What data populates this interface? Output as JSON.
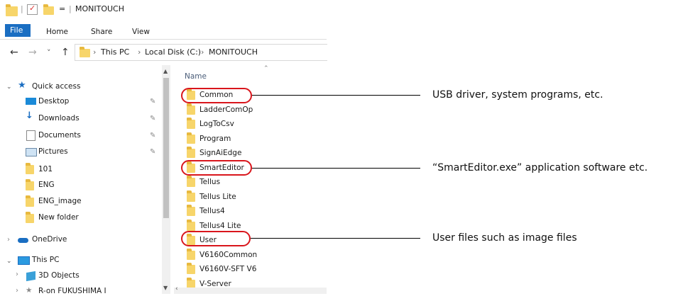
{
  "window": {
    "title": "MONITOUCH",
    "qat_separator": "|",
    "qat_dropdown": "=",
    "title_separator": "|"
  },
  "ribbon": {
    "tabs": [
      "File",
      "Home",
      "Share",
      "View"
    ]
  },
  "address": {
    "back": "←",
    "forward": "→",
    "recent": "˅",
    "up": "↑",
    "crumb_sep": "›",
    "path": [
      "This PC",
      "Local Disk (C:)",
      "MONITOUCH"
    ]
  },
  "nav": {
    "quick_access": "Quick access",
    "quick_items": [
      {
        "label": "Desktop",
        "icon": "desktop-icon",
        "pinned": true
      },
      {
        "label": "Downloads",
        "icon": "download-icon",
        "pinned": true
      },
      {
        "label": "Documents",
        "icon": "document-icon",
        "pinned": true
      },
      {
        "label": "Pictures",
        "icon": "pictures-icon",
        "pinned": true
      },
      {
        "label": "101",
        "icon": "folder-icon",
        "pinned": false
      },
      {
        "label": "ENG",
        "icon": "folder-icon",
        "pinned": false
      },
      {
        "label": "ENG_image",
        "icon": "folder-icon",
        "pinned": false
      },
      {
        "label": "New folder",
        "icon": "folder-icon",
        "pinned": false
      }
    ],
    "onedrive": "OneDrive",
    "this_pc": "This PC",
    "objects3d": "3D Objects",
    "last_item": "R-on FUKUSHIMA I",
    "pin_glyph": "📌"
  },
  "list": {
    "header": "Name",
    "items": [
      "Common",
      "LadderComOp",
      "LogToCsv",
      "Program",
      "SignAiEdge",
      "SmartEditor",
      "Tellus",
      "Tellus Lite",
      "Tellus4",
      "Tellus4 Lite",
      "User",
      "V6160Common",
      "V6160V-SFT V6",
      "V-Server"
    ]
  },
  "annotations": [
    "USB driver, system programs, etc.",
    "“SmartEditor.exe” application software etc.",
    "User files such as image files"
  ],
  "colors": {
    "accent": "#1a6ec2",
    "highlight_oval": "#d9161c",
    "folder": "#f7d56a"
  }
}
